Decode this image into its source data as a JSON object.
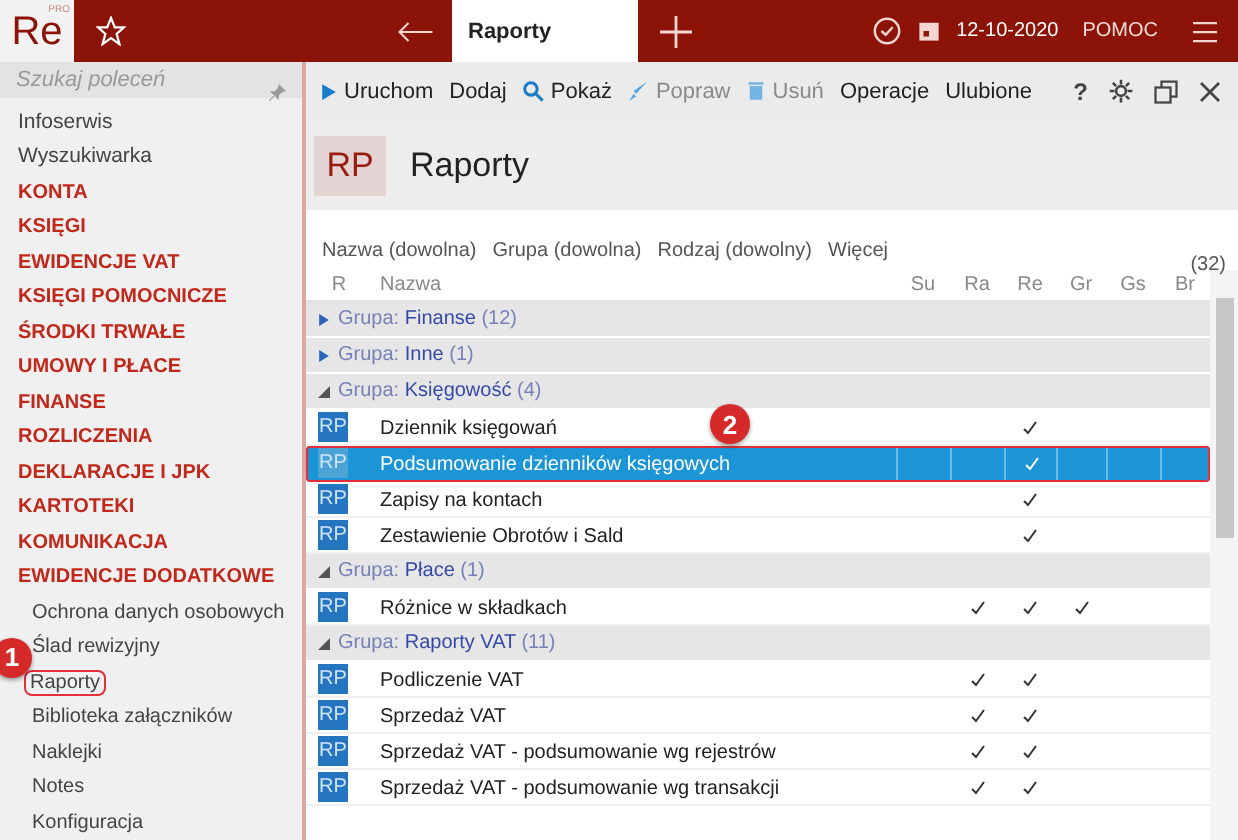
{
  "topbar": {
    "logo": "Re",
    "logo_sup": "PRO",
    "tab": "Raporty",
    "date": "12-10-2020",
    "help": "POMOC"
  },
  "sidebar": {
    "search_placeholder": "Szukaj poleceń",
    "items": [
      {
        "kind": "link",
        "label": "Infoserwis",
        "highlighted": false
      },
      {
        "kind": "link",
        "label": "Wyszukiwarka",
        "highlighted": false
      },
      {
        "kind": "section",
        "label": "KONTA",
        "highlighted": false
      },
      {
        "kind": "section",
        "label": "KSIĘGI",
        "highlighted": false
      },
      {
        "kind": "section",
        "label": "EWIDENCJE VAT",
        "highlighted": false
      },
      {
        "kind": "section",
        "label": "KSIĘGI POMOCNICZE",
        "highlighted": false
      },
      {
        "kind": "section",
        "label": "ŚRODKI TRWAŁE",
        "highlighted": false
      },
      {
        "kind": "section",
        "label": "UMOWY I PŁACE",
        "highlighted": false
      },
      {
        "kind": "section",
        "label": "FINANSE",
        "highlighted": false
      },
      {
        "kind": "section",
        "label": "ROZLICZENIA",
        "highlighted": false
      },
      {
        "kind": "section",
        "label": "DEKLARACJE I JPK",
        "highlighted": false
      },
      {
        "kind": "section",
        "label": "KARTOTEKI",
        "highlighted": false
      },
      {
        "kind": "section",
        "label": "KOMUNIKACJA",
        "highlighted": false
      },
      {
        "kind": "section",
        "label": "EWIDENCJE DODATKOWE",
        "highlighted": false
      },
      {
        "kind": "sub",
        "label": "Ochrona danych osobowych",
        "highlighted": false
      },
      {
        "kind": "sub",
        "label": "Ślad rewizyjny",
        "highlighted": false
      },
      {
        "kind": "sub",
        "label": "Raporty",
        "highlighted": true,
        "callout": "1"
      },
      {
        "kind": "sub",
        "label": "Biblioteka załączników",
        "highlighted": false
      },
      {
        "kind": "sub",
        "label": "Naklejki",
        "highlighted": false
      },
      {
        "kind": "sub",
        "label": "Notes",
        "highlighted": false
      },
      {
        "kind": "sub",
        "label": "Konfiguracja",
        "highlighted": false
      }
    ]
  },
  "toolbar": [
    {
      "kind": "run",
      "label": "Uruchom",
      "disabled": false
    },
    {
      "kind": "plain",
      "label": "Dodaj",
      "disabled": false
    },
    {
      "kind": "search",
      "label": "Pokaż",
      "disabled": false
    },
    {
      "kind": "edit",
      "label": "Popraw",
      "disabled": true
    },
    {
      "kind": "delete",
      "label": "Usuń",
      "disabled": true
    },
    {
      "kind": "plain",
      "label": "Operacje",
      "disabled": false
    },
    {
      "kind": "plain",
      "label": "Ulubione",
      "disabled": false
    }
  ],
  "help_glyph": "?",
  "header": {
    "badge": "RP",
    "title": "Raporty"
  },
  "filters": [
    "Nazwa (dowolna)",
    "Grupa (dowolna)",
    "Rodzaj (dowolny)",
    "Więcej"
  ],
  "count": "(32)",
  "table": {
    "columns": [
      "R",
      "Nazwa",
      "Su",
      "Ra",
      "Re",
      "Gr",
      "Gs",
      "Br"
    ],
    "groups": [
      {
        "prefix": "Grupa:",
        "name": "Finanse",
        "count": "(12)",
        "expanded": false
      },
      {
        "prefix": "Grupa:",
        "name": "Inne",
        "count": "(1)",
        "expanded": false
      },
      {
        "prefix": "Grupa:",
        "name": "Księgowość",
        "count": "(4)",
        "expanded": true,
        "rows": [
          {
            "icon": "RP",
            "name": "Dziennik księgowań",
            "selected": false,
            "checks": [
              false,
              false,
              true,
              false,
              false,
              false
            ]
          },
          {
            "icon": "RP",
            "name": "Podsumowanie dzienników księgowych",
            "selected": true,
            "callout": "2",
            "checks": [
              false,
              false,
              true,
              false,
              false,
              false
            ]
          },
          {
            "icon": "RP",
            "name": "Zapisy na kontach",
            "selected": false,
            "checks": [
              false,
              false,
              true,
              false,
              false,
              false
            ]
          },
          {
            "icon": "RP",
            "name": "Zestawienie Obrotów i Sald",
            "selected": false,
            "checks": [
              false,
              false,
              true,
              false,
              false,
              false
            ]
          }
        ]
      },
      {
        "prefix": "Grupa:",
        "name": "Płace",
        "count": "(1)",
        "expanded": true,
        "rows": [
          {
            "icon": "RP",
            "name": "Różnice w składkach",
            "selected": false,
            "checks": [
              false,
              true,
              true,
              true,
              false,
              false
            ]
          }
        ]
      },
      {
        "prefix": "Grupa:",
        "name": "Raporty VAT",
        "count": "(11)",
        "expanded": true,
        "rows": [
          {
            "icon": "RP",
            "name": "Podliczenie VAT",
            "selected": false,
            "checks": [
              false,
              true,
              true,
              false,
              false,
              false
            ]
          },
          {
            "icon": "RP",
            "name": "Sprzedaż VAT",
            "selected": false,
            "checks": [
              false,
              true,
              true,
              false,
              false,
              false
            ]
          },
          {
            "icon": "RP",
            "name": "Sprzedaż VAT - podsumowanie wg rejestrów",
            "selected": false,
            "checks": [
              false,
              true,
              true,
              false,
              false,
              false
            ]
          },
          {
            "icon": "RP",
            "name": "Sprzedaż VAT - podsumowanie wg transakcji",
            "selected": false,
            "checks": [
              false,
              true,
              true,
              false,
              false,
              false
            ]
          }
        ]
      }
    ]
  }
}
